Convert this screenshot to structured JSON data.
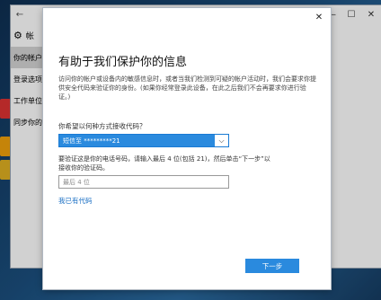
{
  "settings": {
    "back_glyph": "←",
    "header_label": "帐",
    "sidebar_items": [
      "你的帐户",
      "登录选项",
      "工作单位",
      "同步你的"
    ],
    "controls": [
      "—",
      "☐",
      "✕"
    ]
  },
  "dialog": {
    "close_glyph": "✕",
    "title": "有助于我们保护你的信息",
    "description": "访问你的帐户或设备内的敏感信息时，或者当我们检测到可疑的帐户活动时，我们会要求你提供安全代码来验证你的身份。(如果你经常登录此设备，在此之后我们不会再要求你进行验证。)",
    "method_label": "你希望以何种方式接收代码？",
    "method_selected": "短信至 *********21",
    "verify_instruction": "要验证这是你的电话号码，请输入最后 4 位(包括 21)，然后单击“下一步”以接收你的验证码。",
    "digits_placeholder": "最后 4 位",
    "have_code_link": "我已有代码",
    "next_button": "下一步"
  },
  "colors": {
    "accent": "#2a8ade",
    "link": "#1a6fc4"
  }
}
